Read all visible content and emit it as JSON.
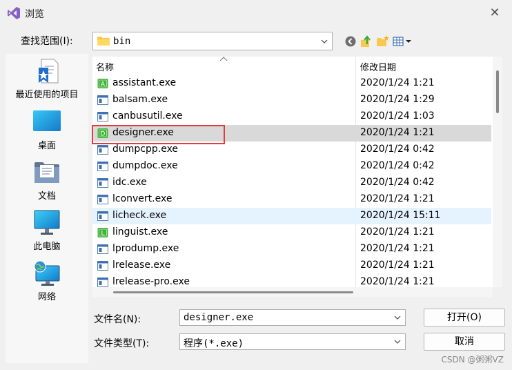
{
  "window": {
    "title": "浏览",
    "close_glyph": "✕"
  },
  "lookin": {
    "label": "查找范围(I):",
    "value": "bin"
  },
  "places": [
    {
      "label": "最近使用的项目"
    },
    {
      "label": "桌面"
    },
    {
      "label": "文档"
    },
    {
      "label": "此电脑"
    },
    {
      "label": "网络"
    }
  ],
  "columns": {
    "name": "名称",
    "date": "修改日期"
  },
  "files": [
    {
      "name": "assistant.exe",
      "date": "2020/1/24 1:21",
      "icon": "qt-app-icon",
      "badge": "A"
    },
    {
      "name": "balsam.exe",
      "date": "2020/1/24 1:29",
      "icon": "exe-window-icon",
      "badge": ""
    },
    {
      "name": "canbusutil.exe",
      "date": "2020/1/24 1:03",
      "icon": "exe-window-icon",
      "badge": ""
    },
    {
      "name": "designer.exe",
      "date": "2020/1/24 1:21",
      "icon": "qt-app-icon",
      "badge": "D"
    },
    {
      "name": "dumpcpp.exe",
      "date": "2020/1/24 0:42",
      "icon": "exe-window-icon",
      "badge": ""
    },
    {
      "name": "dumpdoc.exe",
      "date": "2020/1/24 0:42",
      "icon": "exe-window-icon",
      "badge": ""
    },
    {
      "name": "idc.exe",
      "date": "2020/1/24 0:42",
      "icon": "exe-window-icon",
      "badge": ""
    },
    {
      "name": "lconvert.exe",
      "date": "2020/1/24 1:21",
      "icon": "exe-window-icon",
      "badge": ""
    },
    {
      "name": "licheck.exe",
      "date": "2020/1/24 15:11",
      "icon": "exe-window-icon",
      "badge": ""
    },
    {
      "name": "linguist.exe",
      "date": "2020/1/24 1:21",
      "icon": "qt-app-icon",
      "badge": "L"
    },
    {
      "name": "lprodump.exe",
      "date": "2020/1/24 1:21",
      "icon": "exe-window-icon",
      "badge": ""
    },
    {
      "name": "lrelease.exe",
      "date": "2020/1/24 1:21",
      "icon": "exe-window-icon",
      "badge": ""
    },
    {
      "name": "lrelease-pro.exe",
      "date": "2020/1/24 1:21",
      "icon": "exe-window-icon",
      "badge": ""
    }
  ],
  "selected_index": 3,
  "hover_index": 8,
  "filename": {
    "label": "文件名(N):",
    "value": "designer.exe"
  },
  "filetype": {
    "label": "文件类型(T):",
    "value": "程序(*.exe)"
  },
  "buttons": {
    "open": "打开(O)",
    "cancel": "取消"
  },
  "watermark": "CSDN @粥粥VZ",
  "colors": {
    "accent_red": "#e03c3c",
    "qt_green": "#41b33b",
    "selected_row": "#d9d9d9",
    "hover_row": "#e5f3ff"
  }
}
